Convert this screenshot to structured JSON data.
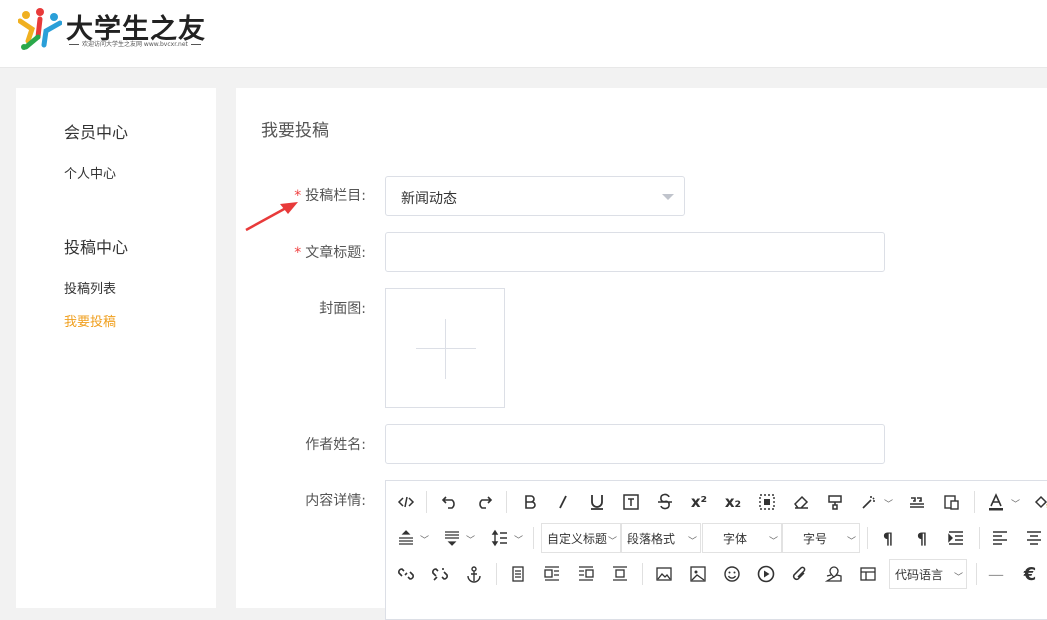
{
  "site": {
    "name": "大学生之友",
    "slogan": "欢迎访问大学生之友网 www.bvcxr.net"
  },
  "sidebar": {
    "groups": [
      {
        "title": "会员中心",
        "items": [
          {
            "label": "个人中心"
          }
        ]
      },
      {
        "title": "投稿中心",
        "items": [
          {
            "label": "投稿列表"
          },
          {
            "label": "我要投稿",
            "active": true
          }
        ]
      }
    ]
  },
  "form": {
    "page_title": "我要投稿",
    "category_label": "投稿栏目:",
    "category_value": "新闻动态",
    "title_label": "文章标题:",
    "cover_label": "封面图:",
    "author_label": "作者姓名:",
    "content_label": "内容详情:",
    "required_mark": "*"
  },
  "editor": {
    "dropdowns": {
      "heading": "自定义标题",
      "paragraph": "段落格式",
      "font": "字体",
      "size": "字号",
      "code": "代码语言"
    }
  },
  "colors": {
    "accent": "#f0a020",
    "required": "#f04040",
    "arrow": "#e83a3a"
  }
}
